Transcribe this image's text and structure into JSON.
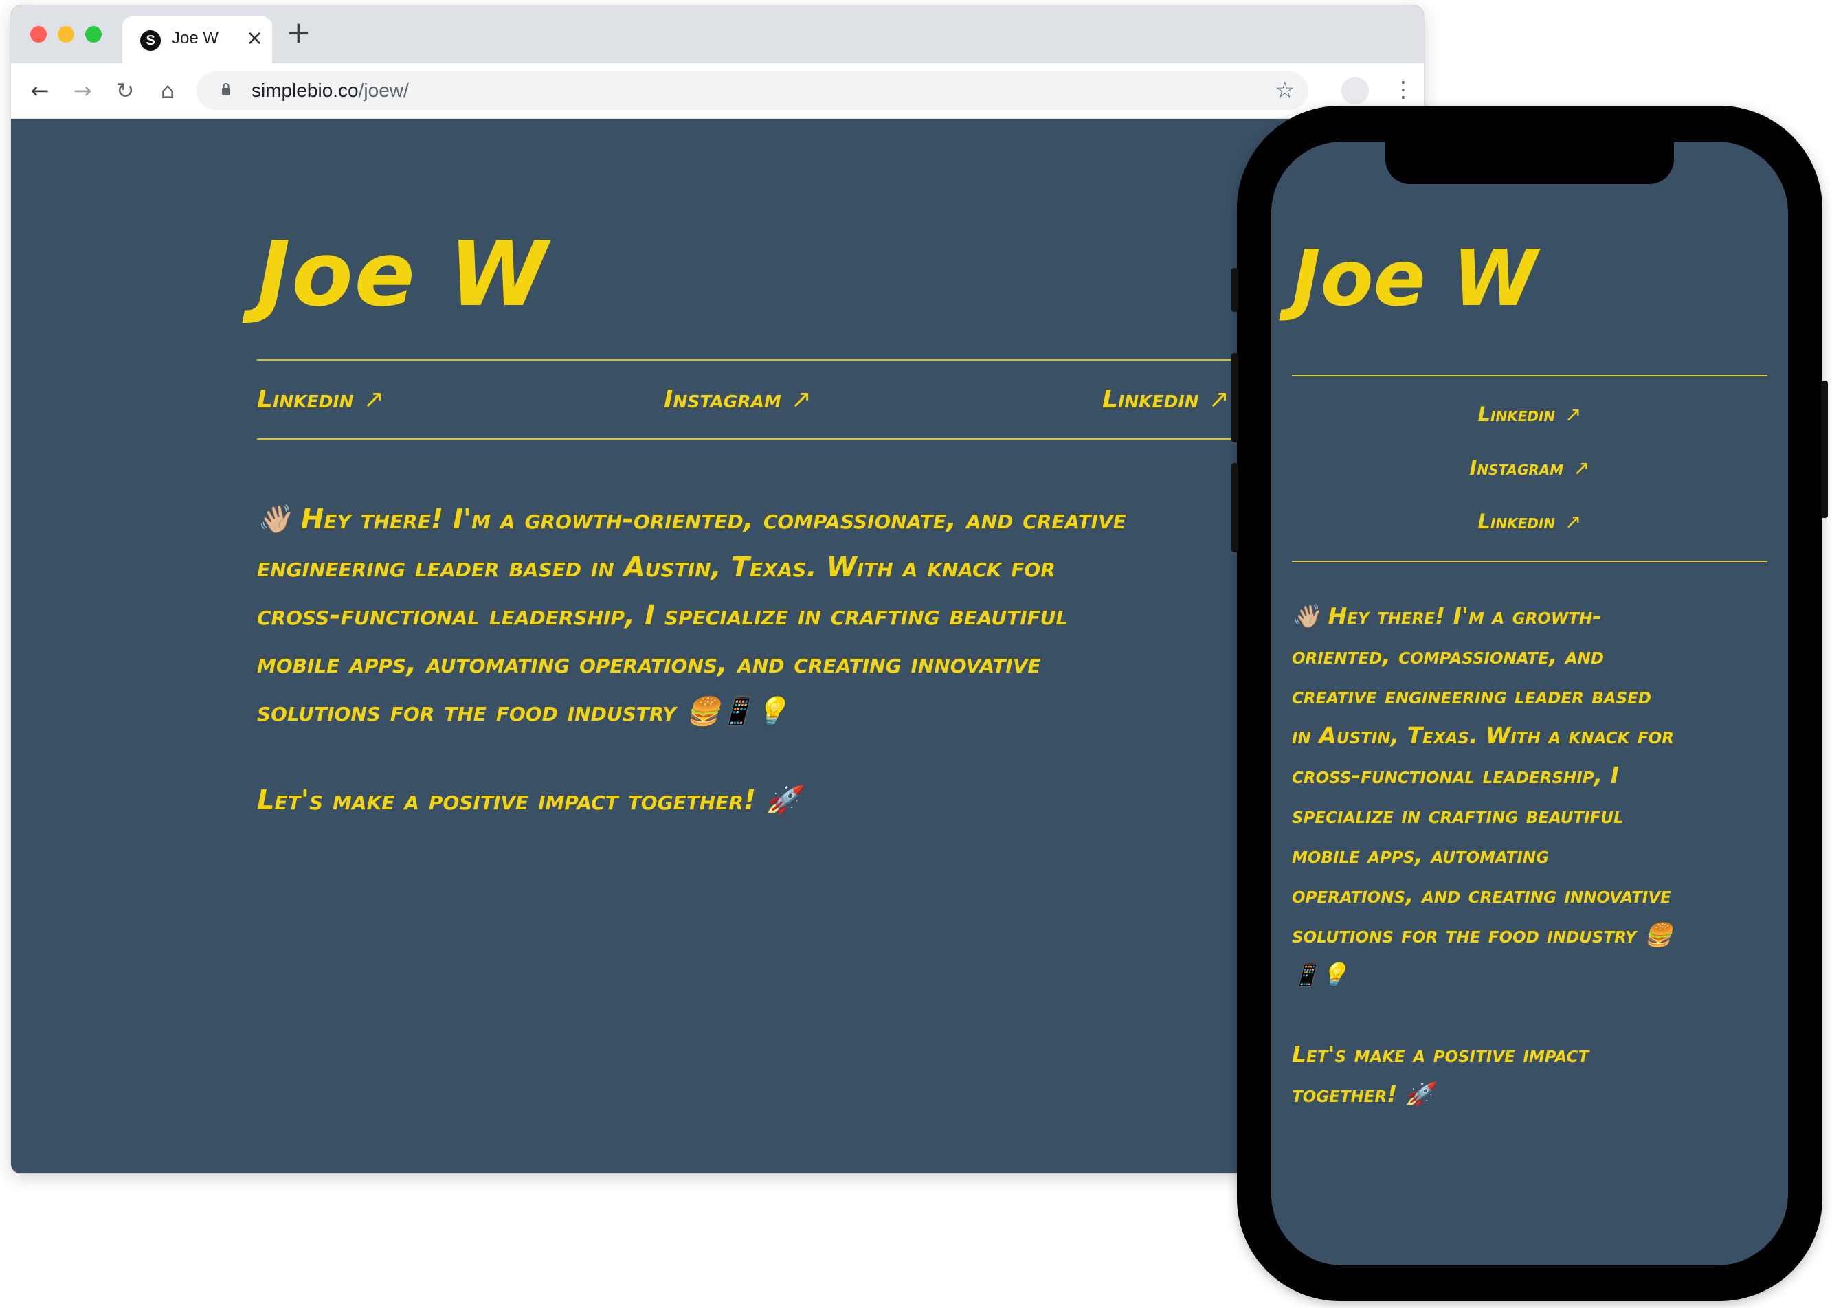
{
  "browser": {
    "tab_title": "Joe W",
    "tab_favicon": "S",
    "tab_close": "×",
    "new_tab": "+",
    "url_domain": "simplebio.co",
    "url_path": "/joew/",
    "icons": {
      "back": "←",
      "forward": "→",
      "reload": "↻",
      "home": "⌂",
      "star": "☆",
      "menu": "⋮"
    }
  },
  "profile": {
    "name": "Joe W",
    "links": [
      {
        "label": "Linkedin",
        "arrow": "↗"
      },
      {
        "label": "Instagram",
        "arrow": "↗"
      },
      {
        "label": "Linkedin",
        "arrow": "↗"
      }
    ]
  },
  "desktop": {
    "bio_lines": "👋🏼 Hey there! I'm a growth-oriented, compassionate, and creative\nengineering leader based in Austin, Texas. With a knack for\ncross-functional leadership, I specialize in crafting beautiful\nmobile apps, automating operations, and creating innovative\nsolutions for the food industry 🍔📱💡",
    "cta": "Let's make a positive impact together! 🚀"
  },
  "mobile": {
    "bio_lines": "👋🏼 Hey there! I'm a growth-\noriented, compassionate, and\ncreative engineering leader based\nin Austin, Texas. With a knack for\ncross-functional leadership, I\nspecialize in crafting beautiful\nmobile apps, automating\noperations, and creating innovative\nsolutions for the food industry 🍔\n📱💡",
    "cta": "Let's make a positive impact\ntogether! 🚀"
  },
  "colors": {
    "background": "#3a5065",
    "accent": "#f4d40f"
  }
}
